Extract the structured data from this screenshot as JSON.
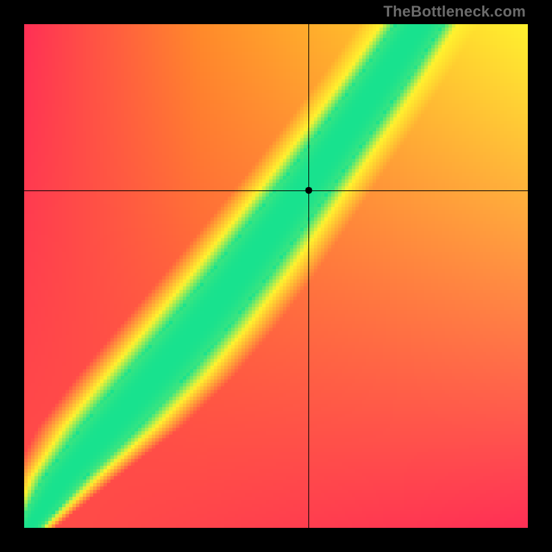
{
  "watermark": "TheBottleneck.com",
  "chart_data": {
    "type": "heatmap",
    "title": "",
    "xlabel": "",
    "ylabel": "",
    "xlim": [
      0,
      1
    ],
    "ylim": [
      0,
      1
    ],
    "crosshair": {
      "x": 0.565,
      "y": 0.67
    },
    "marker": {
      "x": 0.565,
      "y": 0.67
    },
    "gradient": {
      "colors": {
        "red": "#ff2f55",
        "orange": "#ff8a2a",
        "yellow": "#fff22e",
        "green": "#18e28e"
      },
      "ridge_control_points": [
        {
          "t": 0.0,
          "x": 0.01,
          "width": 0.02
        },
        {
          "t": 0.1,
          "x": 0.08,
          "width": 0.04
        },
        {
          "t": 0.2,
          "x": 0.17,
          "width": 0.055
        },
        {
          "t": 0.3,
          "x": 0.26,
          "width": 0.06
        },
        {
          "t": 0.4,
          "x": 0.345,
          "width": 0.06
        },
        {
          "t": 0.5,
          "x": 0.425,
          "width": 0.058
        },
        {
          "t": 0.6,
          "x": 0.5,
          "width": 0.055
        },
        {
          "t": 0.7,
          "x": 0.575,
          "width": 0.052
        },
        {
          "t": 0.8,
          "x": 0.648,
          "width": 0.05
        },
        {
          "t": 0.9,
          "x": 0.718,
          "width": 0.048
        },
        {
          "t": 1.0,
          "x": 0.785,
          "width": 0.046
        }
      ],
      "background_corners": {
        "top_left": "red",
        "top_right": "yellow",
        "bottom_left": "orange",
        "bottom_right": "red"
      }
    },
    "grid": false,
    "legend": false
  }
}
